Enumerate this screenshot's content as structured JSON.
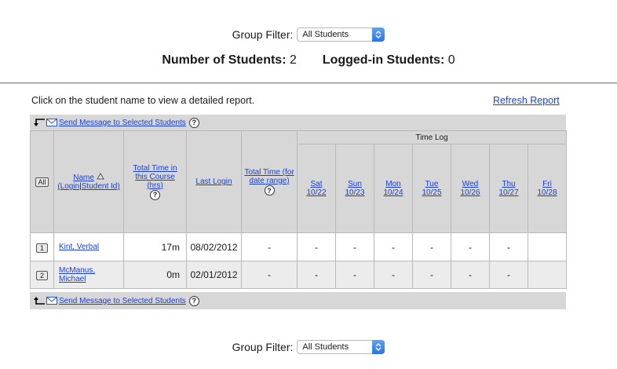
{
  "group_filter": {
    "label": "Group Filter:",
    "value": "All Students"
  },
  "counts": {
    "students_label": "Number of Students:",
    "students_value": "2",
    "logged_label": "Logged-in Students:",
    "logged_value": "0"
  },
  "intro_text": "Click on the student name to view a detailed report.",
  "refresh_label": "Refresh Report",
  "send_message_label": "Send Message to Selected Students",
  "help_glyph": "?",
  "table": {
    "time_log_label": "Time Log",
    "all_label": "All",
    "name_label": "Name",
    "login_label": "(Login",
    "sep": "|",
    "student_id_label": "Student Id)",
    "total_time_course_label": "Total Time in this Course (hrs)",
    "last_login_label": "Last Login",
    "total_time_range_label": "Total Time (for date range)",
    "days": [
      {
        "day": "Sat",
        "date": "10/22"
      },
      {
        "day": "Sun",
        "date": "10/23"
      },
      {
        "day": "Mon",
        "date": "10/24"
      },
      {
        "day": "Tue",
        "date": "10/25"
      },
      {
        "day": "Wed",
        "date": "10/26"
      },
      {
        "day": "Thu",
        "date": "10/27"
      },
      {
        "day": "Fri",
        "date": "10/28"
      }
    ],
    "rows": [
      {
        "num": "1",
        "name": "Kint, Verbal",
        "total": "17m",
        "last_login": "08/02/2012",
        "range": "-",
        "days": [
          "-",
          "-",
          "-",
          "-",
          "-",
          "-",
          ""
        ]
      },
      {
        "num": "2",
        "name": "McManus, Michael",
        "total": "0m",
        "last_login": "02/01/2012",
        "range": "-",
        "days": [
          "-",
          "-",
          "-",
          "-",
          "-",
          "-",
          ""
        ]
      }
    ]
  },
  "colors": {
    "link": "#1a3fd6",
    "header_bg": "#d7d7d7",
    "row_alt_bg": "#ececec",
    "select_accent": "#2a73e6"
  }
}
